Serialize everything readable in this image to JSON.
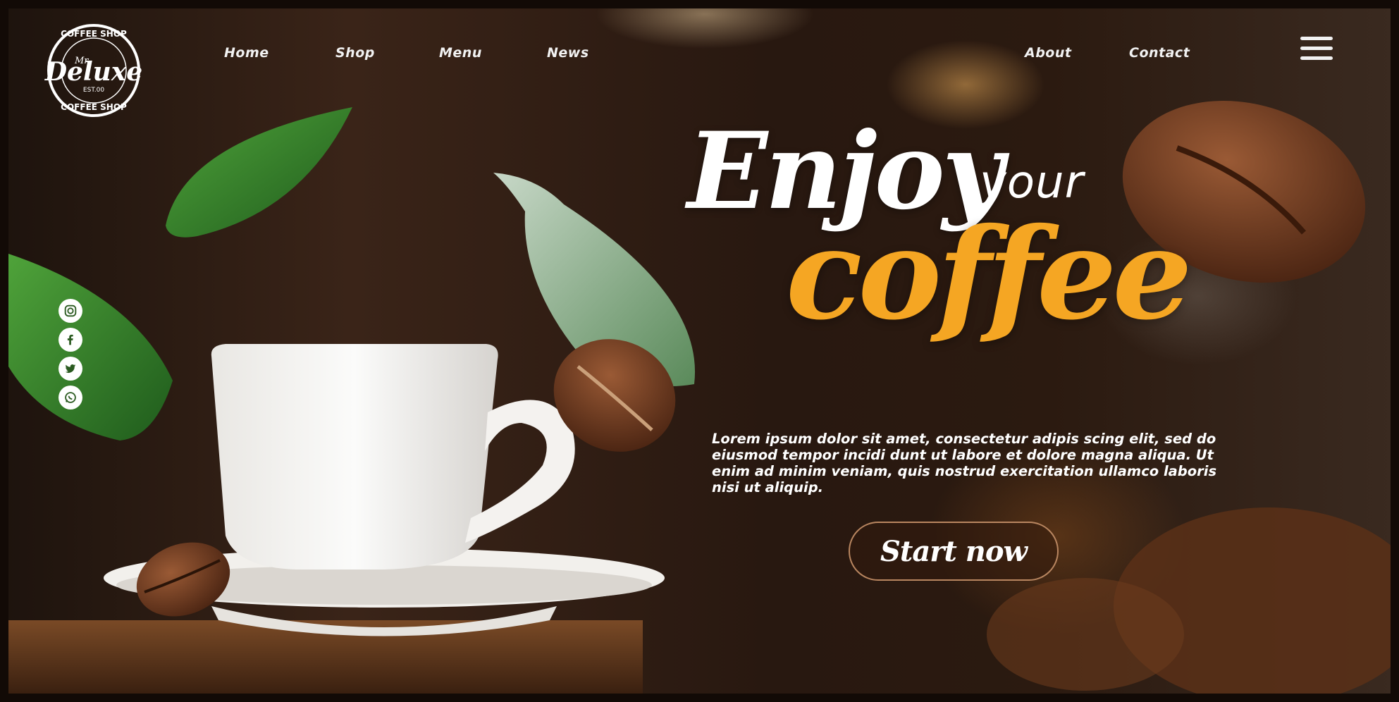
{
  "brand": {
    "logo_top": "COFFEE SHOP",
    "logo_prefix": "Mr",
    "logo_main": "Deluxe",
    "logo_est": "EST.00",
    "logo_bottom": "COFFEE SHOP"
  },
  "nav": {
    "left": [
      "Home",
      "Shop",
      "Menu",
      "News"
    ],
    "right": [
      "About",
      "Contact"
    ],
    "menu_icon": "hamburger-icon"
  },
  "social": [
    "instagram-icon",
    "facebook-icon",
    "twitter-icon",
    "whatsapp-icon"
  ],
  "hero": {
    "headline_1": "Enjoy",
    "headline_2": "your",
    "headline_3": "coffee",
    "body": "Lorem ipsum dolor sit amet, consectetur adipis scing elit, sed do eiusmod tempor incidi dunt ut labore et dolore magna aliqua. Ut enim ad minim veniam, quis nostrud exercitation ullamco laboris nisi ut aliquip.",
    "cta": "Start now"
  },
  "colors": {
    "accent": "#f5a623",
    "text": "#ffffff",
    "background": "#2a1a10"
  }
}
